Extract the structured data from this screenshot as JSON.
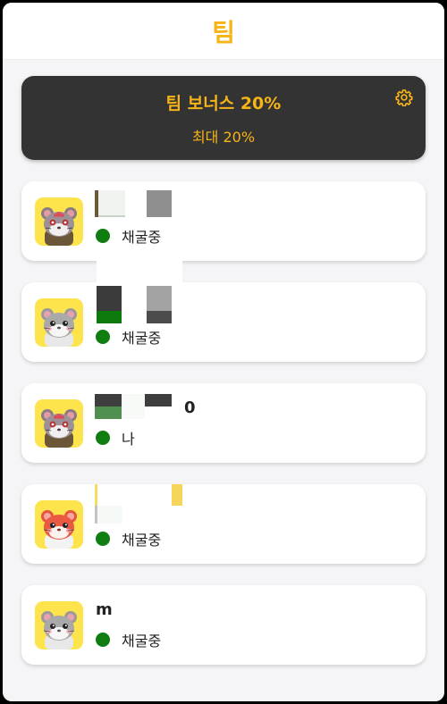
{
  "header": {
    "title": "팀"
  },
  "bonus": {
    "title": "팀 보너스 20%",
    "subtitle": "최대 20%",
    "settings_icon": "gear-icon"
  },
  "colors": {
    "accent": "#f6b416",
    "card_dark": "#333333",
    "status_online": "#0f7d0f",
    "avatar_bg": "#fde34c"
  },
  "members": [
    {
      "name": "",
      "status": "채굴중",
      "avatar": "hamster-brown-flowers"
    },
    {
      "name": "",
      "status": "채굴중",
      "avatar": "hamster-gray"
    },
    {
      "name": "0",
      "status": "나",
      "avatar": "hamster-brown-flowers"
    },
    {
      "name": "",
      "status": "채굴중",
      "avatar": "hamster-red"
    },
    {
      "name": "m",
      "status": "채굴중",
      "avatar": "hamster-gray"
    }
  ]
}
